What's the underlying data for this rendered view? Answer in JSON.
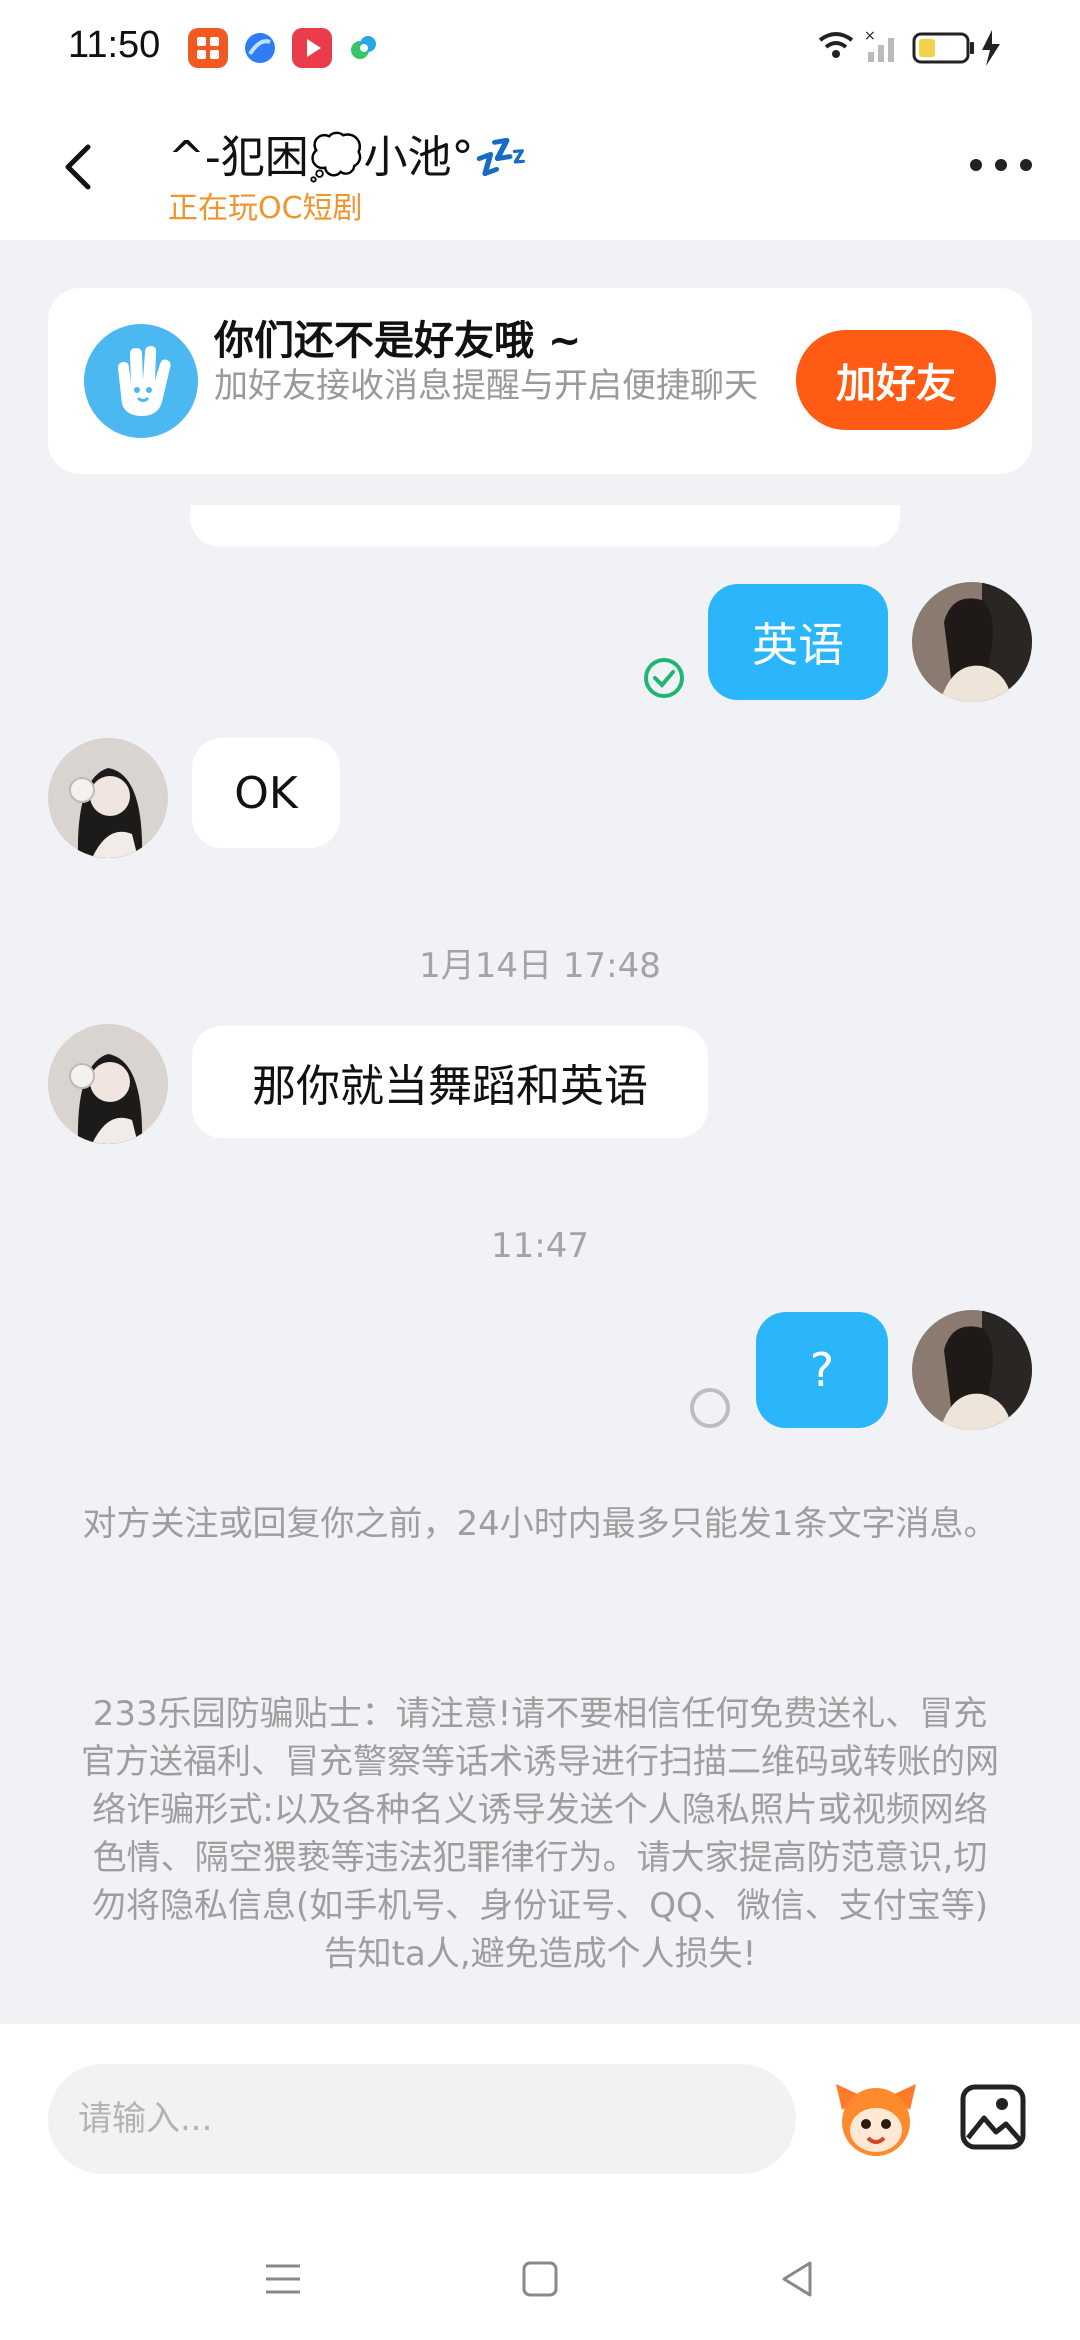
{
  "status_bar": {
    "time": "11:50",
    "app_icons": [
      "grid-app-icon",
      "browser-app-icon",
      "video-app-icon",
      "leaf-app-icon"
    ],
    "icons": [
      "wifi-icon",
      "signal-icon",
      "battery-icon",
      "charging-icon"
    ]
  },
  "header": {
    "title": "^-犯困💭小池°💤",
    "subtitle": "正在玩OC短剧"
  },
  "friend_banner": {
    "title": "你们还不是好友哦 ~",
    "description": "加好友接收消息提醒与开启便捷聊天",
    "button_label": "加好友"
  },
  "messages": [
    {
      "direction": "out",
      "text": "英语",
      "status": "delivered"
    },
    {
      "direction": "in",
      "text": "OK"
    },
    {
      "type": "timestamp",
      "text": "1月14日 17:48"
    },
    {
      "direction": "in",
      "text": "那你就当舞蹈和英语"
    },
    {
      "type": "timestamp",
      "text": "11:47"
    },
    {
      "direction": "out",
      "text": "?",
      "status": "pending"
    }
  ],
  "notices": {
    "limit": "对方关注或回复你之前，24小时内最多只能发1条文字消息。",
    "anti_fraud": "233乐园防骗贴士：请注意!请不要相信任何免费送礼、冒充官方送福利、冒充警察等话术诱导进行扫描二维码或转账的网络诈骗形式:以及各种名义诱导发送个人隐私照片或视频网络色情、隔空猥亵等违法犯罪律行为。请大家提高防范意识,切勿将隐私信息(如手机号、身份证号、QQ、微信、支付宝等)告知ta人,避免造成个人损失!"
  },
  "input": {
    "placeholder": "请输入..."
  },
  "colors": {
    "accent_blue": "#2bb6fb",
    "add_friend_orange": "#ff5b14",
    "subtitle_orange": "#f0952d",
    "background": "#f1f2f6"
  }
}
